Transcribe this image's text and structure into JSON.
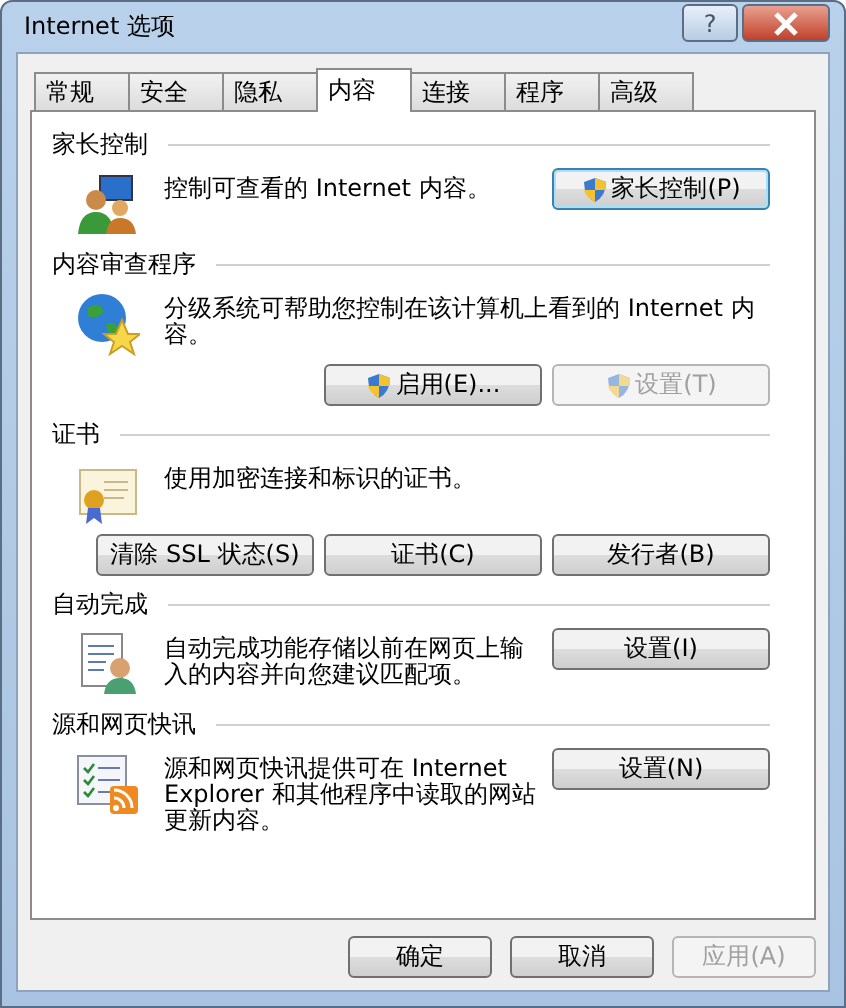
{
  "window": {
    "title": "Internet 选项",
    "help_button": "?"
  },
  "tabs": [
    {
      "label": "常规",
      "selected": false
    },
    {
      "label": "安全",
      "selected": false
    },
    {
      "label": "隐私",
      "selected": false
    },
    {
      "label": "内容",
      "selected": true
    },
    {
      "label": "连接",
      "selected": false
    },
    {
      "label": "程序",
      "selected": false
    },
    {
      "label": "高级",
      "selected": false
    }
  ],
  "sections": [
    {
      "title": "家长控制",
      "kind": "parental",
      "buttons_below": false,
      "description": "控制可查看的 Internet 内容。",
      "buttons": [
        {
          "label": "家长控制(P)",
          "shield": true,
          "disabled": false,
          "focused": true
        }
      ]
    },
    {
      "title": "内容审查程序",
      "kind": "ratings",
      "buttons_below": true,
      "description": "分级系统可帮助您控制在该计算机上看到的 Internet 内容。",
      "buttons": [
        {
          "label": "启用(E)...",
          "shield": true,
          "disabled": false,
          "focused": false
        },
        {
          "label": "设置(T)",
          "shield": true,
          "disabled": true,
          "focused": false
        }
      ]
    },
    {
      "title": "证书",
      "kind": "certificate",
      "buttons_below": true,
      "description": "使用加密连接和标识的证书。",
      "buttons": [
        {
          "label": "清除 SSL 状态(S)",
          "shield": false,
          "disabled": false,
          "focused": false
        },
        {
          "label": "证书(C)",
          "shield": false,
          "disabled": false,
          "focused": false
        },
        {
          "label": "发行者(B)",
          "shield": false,
          "disabled": false,
          "focused": false
        }
      ]
    },
    {
      "title": "自动完成",
      "kind": "autocomplete",
      "buttons_below": false,
      "description": "自动完成功能存储以前在网页上输入的内容并向您建议匹配项。",
      "buttons": [
        {
          "label": "设置(I)",
          "shield": false,
          "disabled": false,
          "focused": false
        }
      ]
    },
    {
      "title": "源和网页快讯",
      "kind": "feeds",
      "buttons_below": false,
      "description": "源和网页快讯提供可在 Internet Explorer 和其他程序中读取的网站更新内容。",
      "buttons": [
        {
          "label": "设置(N)",
          "shield": false,
          "disabled": false,
          "focused": false
        }
      ]
    }
  ],
  "footer_buttons": [
    {
      "label": "确定",
      "disabled": false
    },
    {
      "label": "取消",
      "disabled": false
    },
    {
      "label": "应用(A)",
      "disabled": true
    }
  ]
}
